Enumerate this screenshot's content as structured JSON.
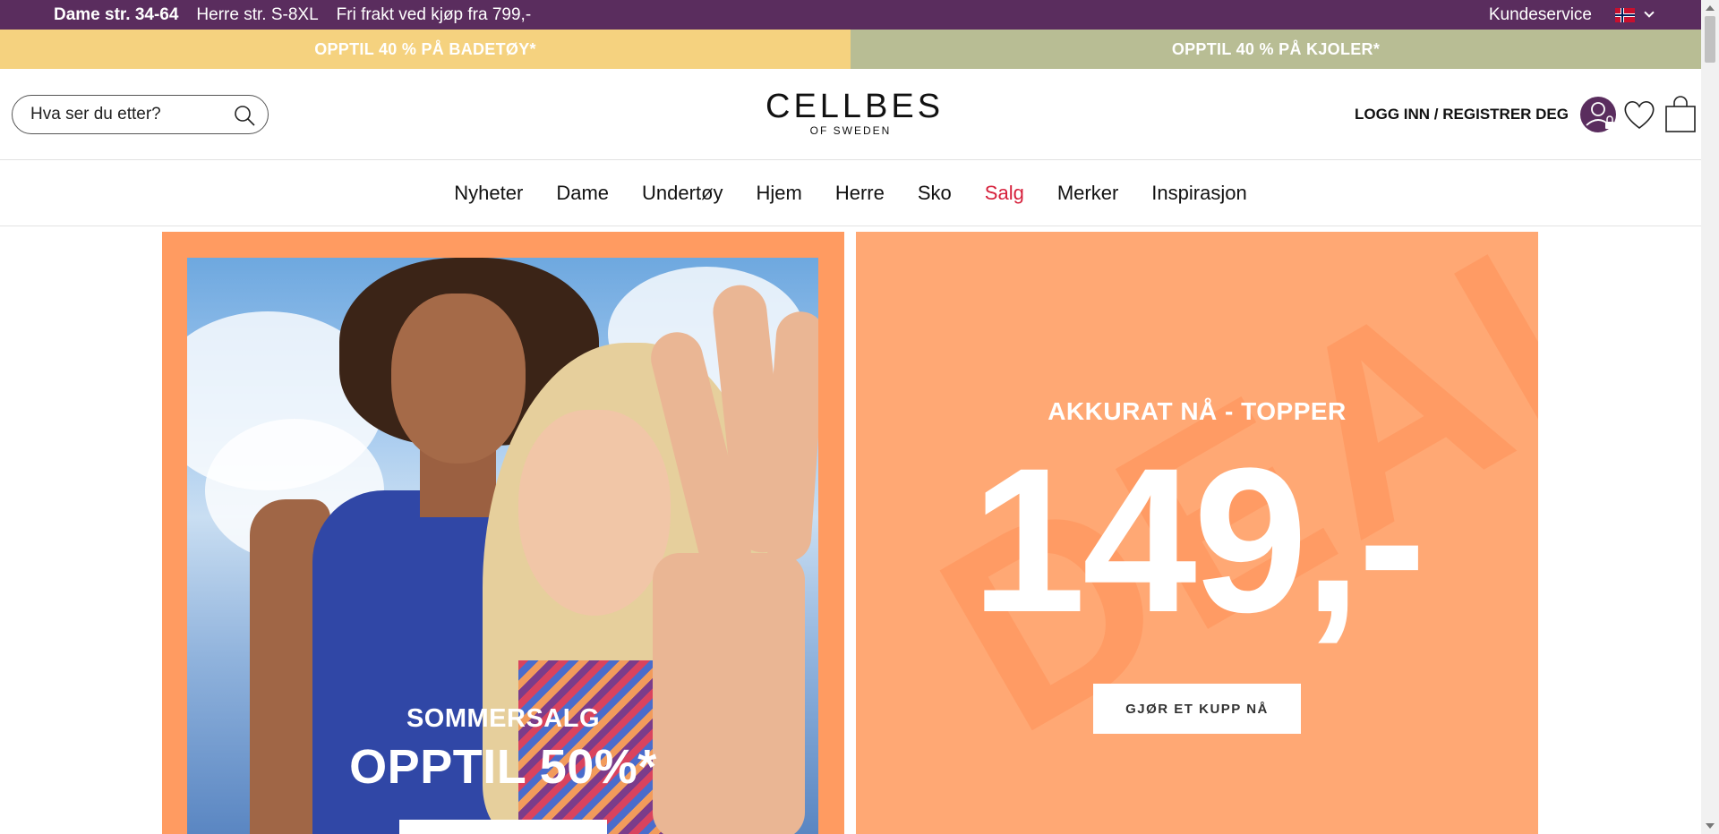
{
  "topbar": {
    "usp_women": "Dame str. 34-64",
    "usp_men": "Herre str. S-8XL",
    "usp_shipping": "Fri frakt ved kjøp fra 799,-",
    "customer_service": "Kundeservice",
    "language_icon": "norway-flag-icon"
  },
  "promo": {
    "left": "OPPTIL 40 % PÅ BADETØY*",
    "right": "OPPTIL 40 % PÅ KJOLER*",
    "left_color": "#f5d27f",
    "right_color": "#b8bd94"
  },
  "header": {
    "search_placeholder": "Hva ser du etter?",
    "logo_main": "CELLBES",
    "logo_sub": "OF SWEDEN",
    "login_label": "LOGG INN / REGISTRER DEG"
  },
  "nav": {
    "items": [
      "Nyheter",
      "Dame",
      "Undertøy",
      "Hjem",
      "Herre",
      "Sko",
      "Salg",
      "Merker",
      "Inspirasjon"
    ],
    "sale_color": "#d6203b"
  },
  "hero_left": {
    "eyebrow": "SOMMERSALG",
    "headline": "OPPTIL 50%*",
    "background": "#ff9b61"
  },
  "hero_right": {
    "eyebrow": "AKKURAT NÅ - TOPPER",
    "price": "149,-",
    "cta": "GJØR ET KUPP NÅ",
    "background": "#ffa874"
  },
  "colors": {
    "brand_purple": "#5a2d5e"
  }
}
